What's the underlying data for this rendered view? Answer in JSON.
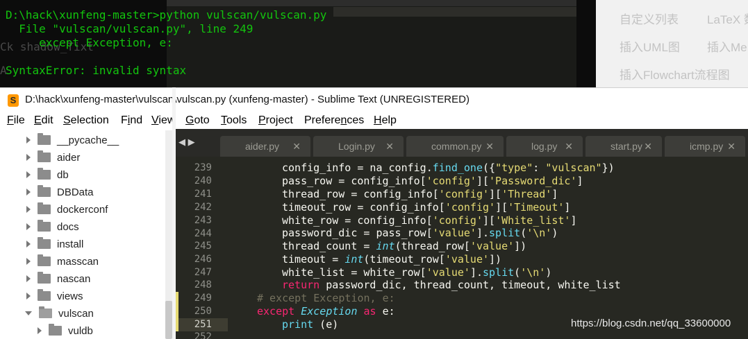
{
  "terminal": {
    "line1": "D:\\hack\\xunfeng-master>python vulscan/vulscan.py",
    "line2": "  File \"vulscan/vulscan.py\", line 249",
    "line3": "     except Exception, e:",
    "line4": "SyntaxError: invalid syntax"
  },
  "background_faded": {
    "left1": "Ck shadow_Tixt",
    "left2": "A"
  },
  "background_web": {
    "item1": "自定义列表",
    "item2": "LaTeX 数",
    "item3": "插入UML图",
    "item4": "插入Me",
    "item5": "插入Flowchart流程图"
  },
  "window": {
    "title": "D:\\hack\\xunfeng-master\\vulscan\\vulscan.py (xunfeng-master) - Sublime Text (UNREGISTERED)",
    "logo": "S"
  },
  "menu": {
    "file_u": "F",
    "file_rest": "ile",
    "edit_u": "E",
    "edit_rest": "dit",
    "selection_u": "S",
    "selection_rest": "election",
    "find_a": "F",
    "find_u": "i",
    "find_rest": "nd",
    "view_u": "V",
    "view_rest": "iew",
    "goto_u": "G",
    "goto_rest": "oto",
    "tools_u": "T",
    "tools_rest": "ools",
    "project_u": "P",
    "project_rest": "roject",
    "prefs_a": "Prefere",
    "prefs_u": "n",
    "prefs_rest": "ces",
    "help_u": "H",
    "help_rest": "elp"
  },
  "sidebar": {
    "items": [
      {
        "label": "__pycache__"
      },
      {
        "label": "aider"
      },
      {
        "label": "db"
      },
      {
        "label": "DBData"
      },
      {
        "label": "dockerconf"
      },
      {
        "label": "docs"
      },
      {
        "label": "install"
      },
      {
        "label": "masscan"
      },
      {
        "label": "nascan"
      },
      {
        "label": "views"
      },
      {
        "label": "vulscan"
      },
      {
        "label": "vuldb"
      }
    ]
  },
  "tabs": {
    "nav": "◀ ▶",
    "close": "✕",
    "items": [
      {
        "label": "aider.py"
      },
      {
        "label": "Login.py"
      },
      {
        "label": "common.py"
      },
      {
        "label": "log.py"
      },
      {
        "label": "start.py"
      },
      {
        "label": "icmp.py"
      }
    ]
  },
  "editor": {
    "line_numbers": [
      "239",
      "240",
      "241",
      "242",
      "243",
      "244",
      "245",
      "246",
      "247",
      "248",
      "249",
      "250",
      "251",
      "252"
    ],
    "current_line": "251",
    "code": {
      "l239_a": "config_info = na_config.",
      "l239_fn": "find_one",
      "l239_b": "({",
      "l239_s1": "\"type\"",
      "l239_c": ": ",
      "l239_s2": "\"vulscan\"",
      "l239_d": "})",
      "l240_a": "pass_row = config_info[",
      "l240_s1": "'config'",
      "l240_b": "][",
      "l240_s2": "'Password_dic'",
      "l240_c": "]",
      "l241_a": "thread_row = config_info[",
      "l241_s1": "'config'",
      "l241_b": "][",
      "l241_s2": "'Thread'",
      "l241_c": "]",
      "l242_a": "timeout_row = config_info[",
      "l242_s1": "'config'",
      "l242_b": "][",
      "l242_s2": "'Timeout'",
      "l242_c": "]",
      "l243_a": "white_row = config_info[",
      "l243_s1": "'config'",
      "l243_b": "][",
      "l243_s2": "'White_list'",
      "l243_c": "]",
      "l244_a": "password_dic = pass_row[",
      "l244_s1": "'value'",
      "l244_b": "].",
      "l244_fn": "split",
      "l244_c": "(",
      "l244_s2": "'\\n'",
      "l244_d": ")",
      "l245_a": "thread_count = ",
      "l245_it": "int",
      "l245_b": "(thread_row[",
      "l245_s1": "'value'",
      "l245_c": "])",
      "l246_a": "timeout = ",
      "l246_it": "int",
      "l246_b": "(timeout_row[",
      "l246_s1": "'value'",
      "l246_c": "])",
      "l247_a": "white_list = white_row[",
      "l247_s1": "'value'",
      "l247_b": "].",
      "l247_fn": "split",
      "l247_c": "(",
      "l247_s2": "'\\n'",
      "l247_d": ")",
      "l248_kw": "return",
      "l248_a": " password_dic, thread_count, timeout, white_list",
      "l249_cm": "# except Exception, e:",
      "l250_kw": "except",
      "l250_it": "Exception",
      "l250_kw2": "as",
      "l250_a": " e:",
      "l251_fn": "print",
      "l251_a": " (e)"
    }
  },
  "watermark": "https://blog.csdn.net/qq_33600000",
  "colors": {
    "terminal_text": "#13c40e",
    "editor_bg": "#272822",
    "keyword": "#f92672",
    "string": "#e6db74",
    "function": "#66d9ef",
    "comment": "#75715e",
    "logo": "#ff9800"
  }
}
